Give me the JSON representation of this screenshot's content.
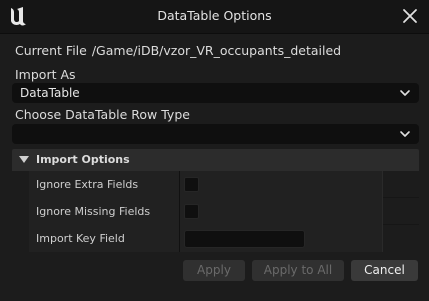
{
  "window": {
    "title": "DataTable Options",
    "logo_icon": "unreal-engine-logo-icon",
    "close_icon": "close-icon"
  },
  "current_file": {
    "label": "Current File",
    "path": "/Game/iDB/vzor_VR_occupants_detailed"
  },
  "import_as": {
    "label": "Import As",
    "value": "DataTable"
  },
  "row_type": {
    "label": "Choose DataTable Row Type",
    "value": ""
  },
  "import_options": {
    "header": "Import Options",
    "rows": [
      {
        "label": "Ignore Extra Fields",
        "type": "checkbox",
        "checked": false
      },
      {
        "label": "Ignore Missing Fields",
        "type": "checkbox",
        "checked": false
      },
      {
        "label": "Import Key Field",
        "type": "text",
        "value": ""
      }
    ]
  },
  "buttons": {
    "apply": "Apply",
    "apply_to_all": "Apply to All",
    "cancel": "Cancel"
  },
  "colors": {
    "background": "#1c1c1c",
    "titlebar": "#151515",
    "field": "#0f0f0f",
    "section_header": "#2c2c2c"
  }
}
